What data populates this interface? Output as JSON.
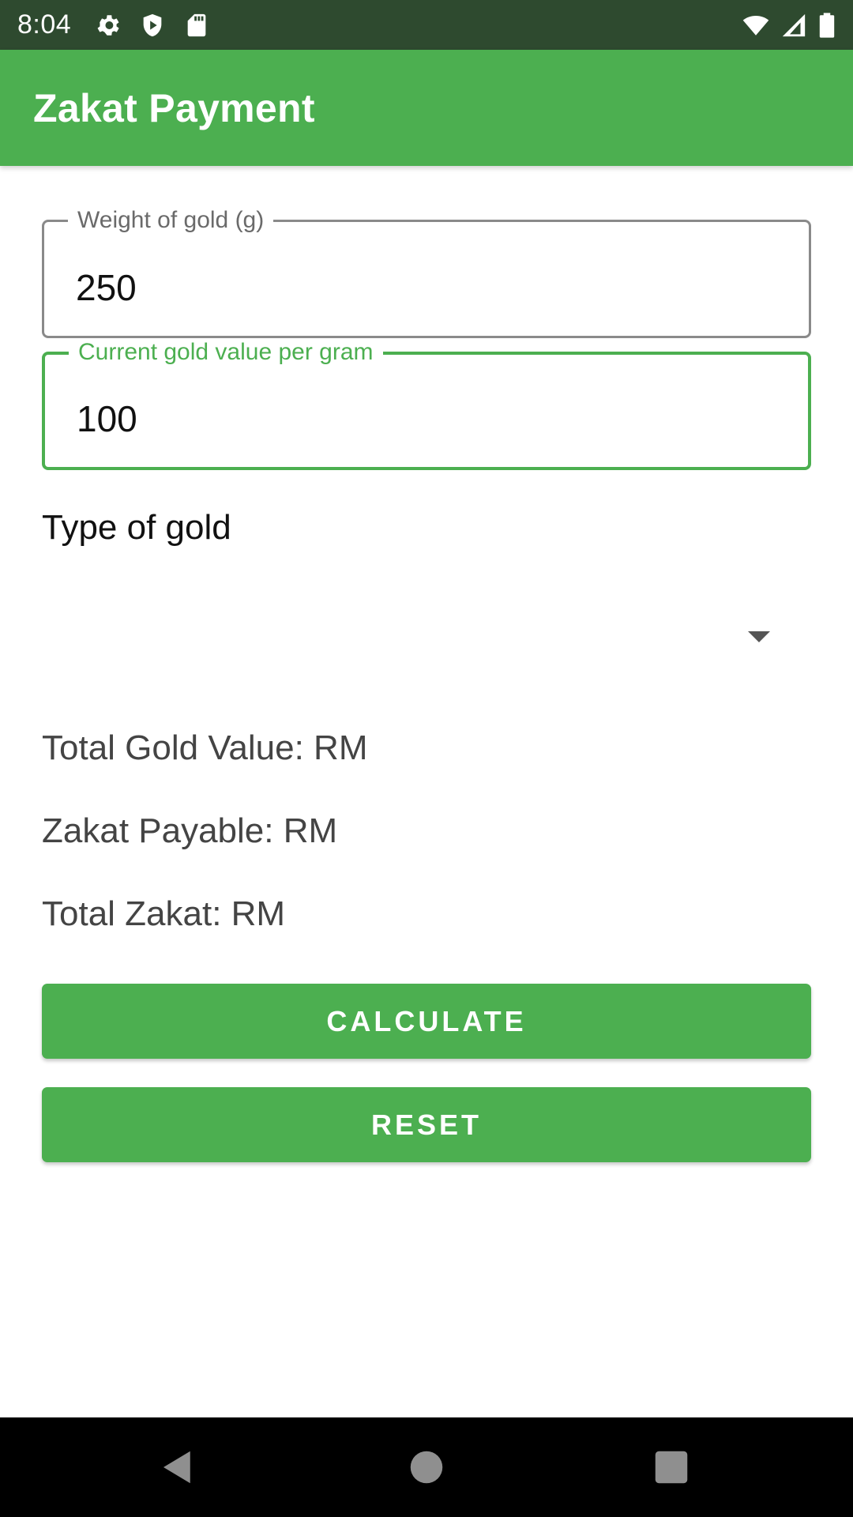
{
  "status_bar": {
    "time": "8:04",
    "icons_left": [
      "settings-icon",
      "shield-icon",
      "sd-card-icon"
    ],
    "icons_right": [
      "wifi-icon",
      "signal-icon",
      "battery-icon"
    ]
  },
  "app_bar": {
    "title": "Zakat Payment",
    "color": "#4caf50"
  },
  "form": {
    "weight_field": {
      "label": "Weight of gold (g)",
      "value": "250"
    },
    "price_field": {
      "label": "Current gold value per gram",
      "value": "100"
    },
    "type_label": "Type of gold",
    "type_selected": ""
  },
  "results": {
    "total_gold_value": "Total Gold Value: RM",
    "zakat_payable": "Zakat Payable: RM",
    "total_zakat": "Total Zakat: RM"
  },
  "buttons": {
    "calculate": "CALCULATE",
    "reset": "RESET"
  },
  "nav_bar": {
    "icons": [
      "back-icon",
      "home-icon",
      "recents-icon"
    ]
  }
}
